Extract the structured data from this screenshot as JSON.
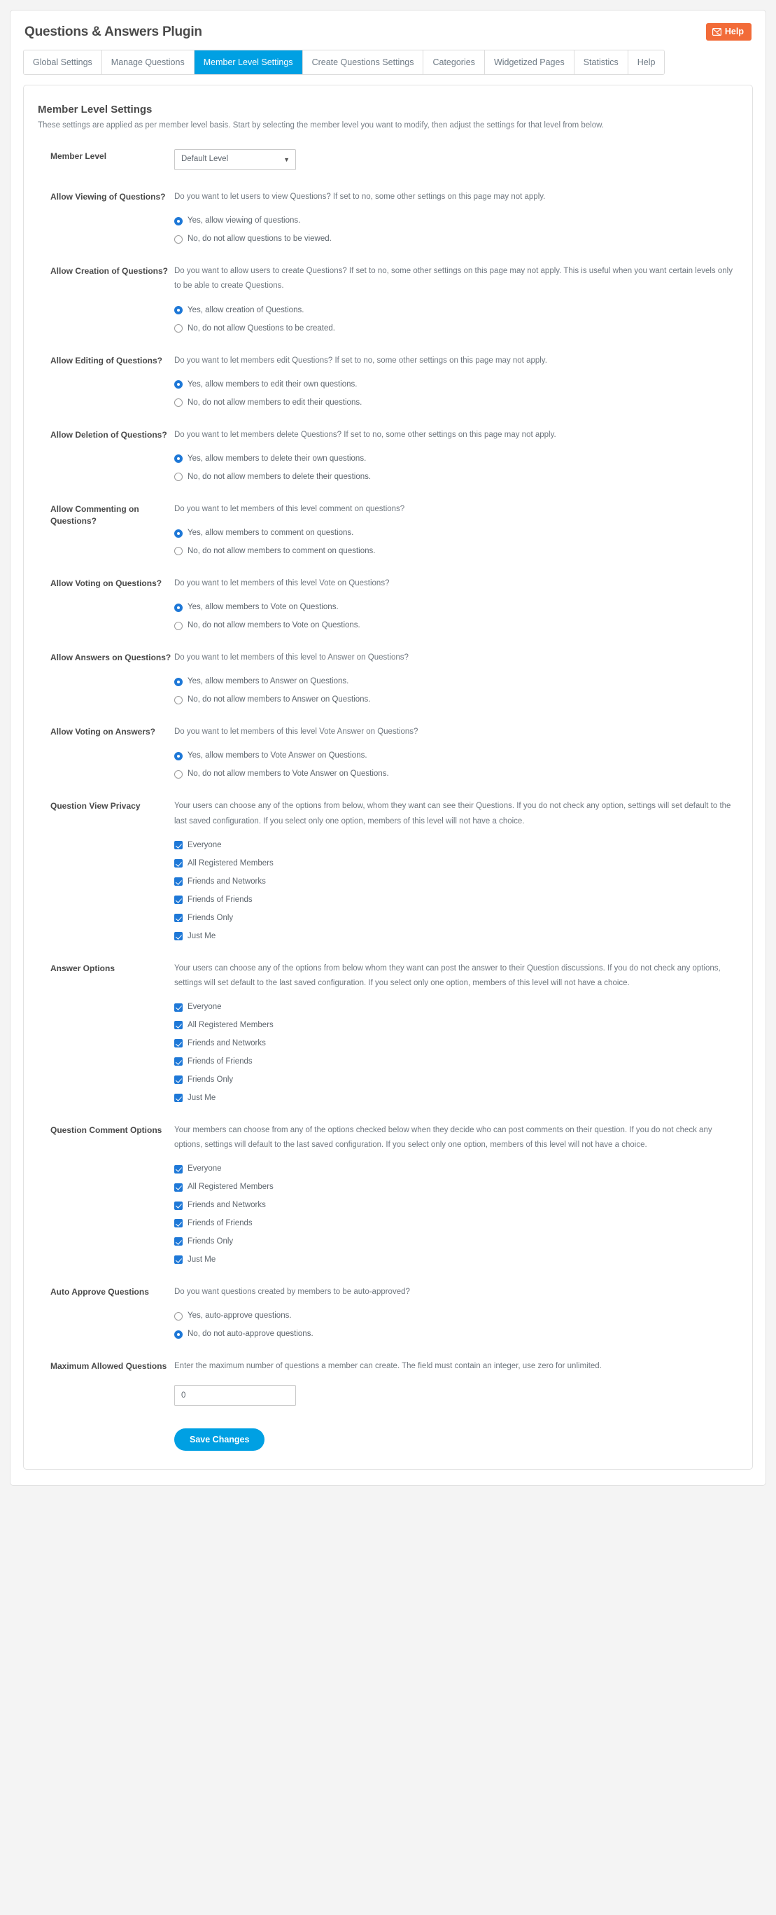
{
  "header": {
    "title": "Questions & Answers Plugin",
    "help_label": "Help",
    "help_accent": "#f26b38"
  },
  "tabs": {
    "active_index": 2,
    "items": [
      {
        "label": "Global Settings"
      },
      {
        "label": "Manage Questions"
      },
      {
        "label": "Member Level Settings"
      },
      {
        "label": "Create Questions Settings"
      },
      {
        "label": "Categories"
      },
      {
        "label": "Widgetized Pages"
      },
      {
        "label": "Statistics"
      },
      {
        "label": "Help"
      }
    ],
    "active_color": "#00a0e3"
  },
  "panel": {
    "title": "Member Level Settings",
    "subtitle": "These settings are applied as per member level basis. Start by selecting the member level you want to modify, then adjust the settings for that level from below."
  },
  "member_level": {
    "label": "Member Level",
    "selected": "Default Level",
    "options": [
      "Default Level"
    ]
  },
  "sections": {
    "viewing": {
      "label": "Allow Viewing of Questions?",
      "desc": "Do you want to let users to view Questions? If set to no, some other settings on this page may not apply.",
      "options": [
        {
          "label": "Yes, allow viewing of questions.",
          "checked": true
        },
        {
          "label": "No, do not allow questions to be viewed.",
          "checked": false
        }
      ]
    },
    "creation": {
      "label": "Allow Creation of Questions?",
      "desc": "Do you want to allow users to create Questions? If set to no, some other settings on this page may not apply. This is useful when you want certain levels only to be able to create Questions.",
      "options": [
        {
          "label": "Yes, allow creation of Questions.",
          "checked": true
        },
        {
          "label": "No, do not allow Questions to be created.",
          "checked": false
        }
      ]
    },
    "editing": {
      "label": "Allow Editing of Questions?",
      "desc": "Do you want to let members edit Questions? If set to no, some other settings on this page may not apply.",
      "options": [
        {
          "label": "Yes, allow members to edit their own questions.",
          "checked": true
        },
        {
          "label": "No, do not allow members to edit their questions.",
          "checked": false
        }
      ]
    },
    "deletion": {
      "label": "Allow Deletion of Questions?",
      "desc": "Do you want to let members delete Questions? If set to no, some other settings on this page may not apply.",
      "options": [
        {
          "label": "Yes, allow members to delete their own questions.",
          "checked": true
        },
        {
          "label": "No, do not allow members to delete their questions.",
          "checked": false
        }
      ]
    },
    "commenting": {
      "label": "Allow Commenting on Questions?",
      "desc": "Do you want to let members of this level comment on questions?",
      "options": [
        {
          "label": "Yes, allow members to comment on questions.",
          "checked": true
        },
        {
          "label": "No, do not allow members to comment on questions.",
          "checked": false
        }
      ]
    },
    "voting_questions": {
      "label": "Allow Voting on Questions?",
      "desc": "Do you want to let members of this level Vote on Questions?",
      "options": [
        {
          "label": "Yes, allow members to Vote on Questions.",
          "checked": true
        },
        {
          "label": "No, do not allow members to Vote on Questions.",
          "checked": false
        }
      ]
    },
    "answers": {
      "label": "Allow Answers on Questions?",
      "desc": "Do you want to let members of this level to Answer on Questions?",
      "options": [
        {
          "label": "Yes, allow members to Answer on Questions.",
          "checked": true
        },
        {
          "label": "No, do not allow members to Answer on Questions.",
          "checked": false
        }
      ]
    },
    "voting_answers": {
      "label": "Allow Voting on Answers?",
      "desc": "Do you want to let members of this level Vote Answer on Questions?",
      "options": [
        {
          "label": "Yes, allow members to Vote Answer on Questions.",
          "checked": true
        },
        {
          "label": "No, do not allow members to Vote Answer on Questions.",
          "checked": false
        }
      ]
    },
    "view_privacy": {
      "label": "Question View Privacy",
      "desc": "Your users can choose any of the options from below, whom they want can see their Questions. If you do not check any option, settings will set default to the last saved configuration. If you select only one option, members of this level will not have a choice.",
      "options": [
        {
          "label": "Everyone",
          "checked": true
        },
        {
          "label": "All Registered Members",
          "checked": true
        },
        {
          "label": "Friends and Networks",
          "checked": true
        },
        {
          "label": "Friends of Friends",
          "checked": true
        },
        {
          "label": "Friends Only",
          "checked": true
        },
        {
          "label": "Just Me",
          "checked": true
        }
      ]
    },
    "answer_options": {
      "label": "Answer Options",
      "desc": "Your users can choose any of the options from below whom they want can post the answer to their Question discussions. If you do not check any options, settings will set default to the last saved configuration. If you select only one option, members of this level will not have a choice.",
      "options": [
        {
          "label": "Everyone",
          "checked": true
        },
        {
          "label": "All Registered Members",
          "checked": true
        },
        {
          "label": "Friends and Networks",
          "checked": true
        },
        {
          "label": "Friends of Friends",
          "checked": true
        },
        {
          "label": "Friends Only",
          "checked": true
        },
        {
          "label": "Just Me",
          "checked": true
        }
      ]
    },
    "comment_options": {
      "label": "Question Comment Options",
      "desc": "Your members can choose from any of the options checked below when they decide who can post comments on their question. If you do not check any options, settings will default to the last saved configuration. If you select only one option, members of this level will not have a choice.",
      "options": [
        {
          "label": "Everyone",
          "checked": true
        },
        {
          "label": "All Registered Members",
          "checked": true
        },
        {
          "label": "Friends and Networks",
          "checked": true
        },
        {
          "label": "Friends of Friends",
          "checked": true
        },
        {
          "label": "Friends Only",
          "checked": true
        },
        {
          "label": "Just Me",
          "checked": true
        }
      ]
    },
    "auto_approve": {
      "label": "Auto Approve Questions",
      "desc": "Do you want questions created by members to be auto-approved?",
      "options": [
        {
          "label": "Yes, auto-approve questions.",
          "checked": false
        },
        {
          "label": "No, do not auto-approve questions.",
          "checked": true
        }
      ]
    },
    "max_questions": {
      "label": "Maximum Allowed Questions",
      "desc": "Enter the maximum number of questions a member can create. The field must contain an integer, use zero for unlimited.",
      "value": "0",
      "placeholder": "0"
    }
  },
  "save": {
    "label": "Save Changes",
    "color": "#00a0e3"
  }
}
